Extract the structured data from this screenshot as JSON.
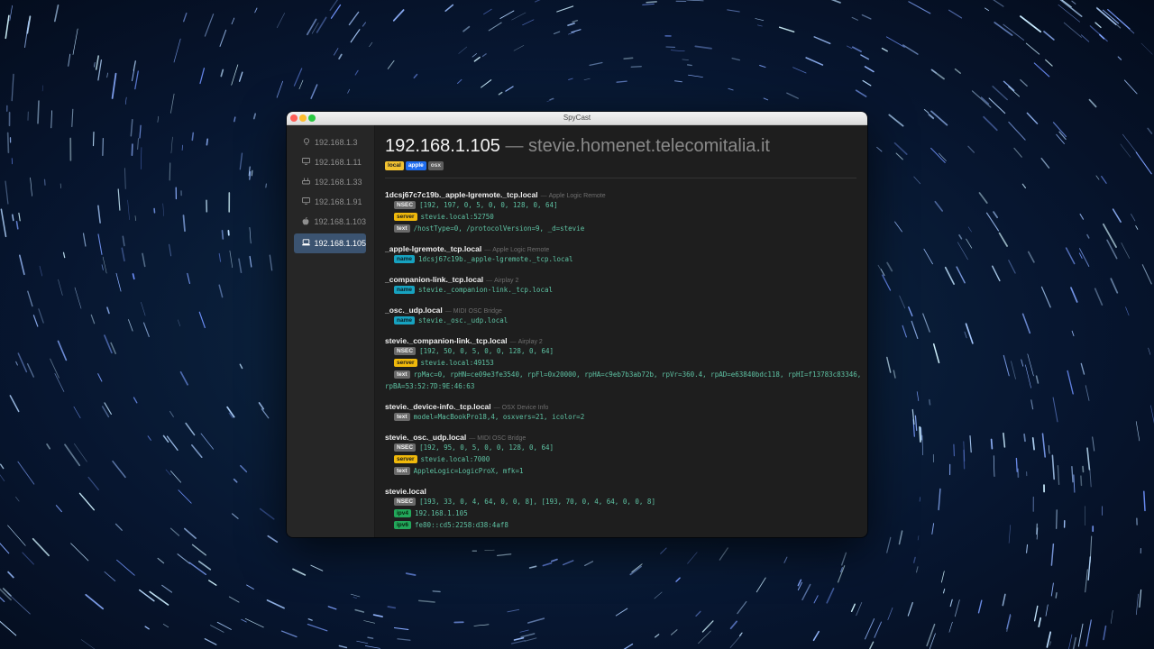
{
  "window": {
    "title": "SpyCast"
  },
  "sidebar": {
    "items": [
      {
        "label": "192.168.1.3",
        "icon": "lightbulb-icon"
      },
      {
        "label": "192.168.1.11",
        "icon": "monitor-icon"
      },
      {
        "label": "192.168.1.33",
        "icon": "router-icon"
      },
      {
        "label": "192.168.1.91",
        "icon": "monitor-icon"
      },
      {
        "label": "192.168.1.103",
        "icon": "apple-icon"
      },
      {
        "label": "192.168.1.105",
        "icon": "laptop-icon",
        "active": true
      }
    ]
  },
  "main": {
    "ip": "192.168.1.105",
    "dash": "—",
    "hostname": "stevie.homenet.telecomitalia.it",
    "tags": [
      "local",
      "apple",
      "osx"
    ]
  },
  "services": [
    {
      "name": "1dcsj67c7c19b._apple-lgremote._tcp.local",
      "description": "Apple Logic Remote",
      "records": [
        {
          "type": "NSEC",
          "value": "[192, 197, 0, 5, 0, 0, 128, 0, 64]"
        },
        {
          "type": "server",
          "value": "stevie.local:52750"
        },
        {
          "type": "text",
          "value": "/hostType=0, /protocolVersion=9, _d=stevie"
        }
      ]
    },
    {
      "name": "_apple-lgremote._tcp.local",
      "description": "Apple Logic Remote",
      "records": [
        {
          "type": "name",
          "value": "1dcsj67c19b._apple-lgremote._tcp.local"
        }
      ]
    },
    {
      "name": "_companion-link._tcp.local",
      "description": "Airplay 2",
      "records": [
        {
          "type": "name",
          "value": "stevie._companion-link._tcp.local"
        }
      ]
    },
    {
      "name": "_osc._udp.local",
      "description": "MIDI OSC Bridge",
      "records": [
        {
          "type": "name",
          "value": "stevie._osc._udp.local"
        }
      ]
    },
    {
      "name": "stevie._companion-link._tcp.local",
      "description": "Airplay 2",
      "records": [
        {
          "type": "NSEC",
          "value": "[192, 50, 0, 5, 0, 0, 128, 0, 64]"
        },
        {
          "type": "server",
          "value": "stevie.local:49153"
        },
        {
          "type": "text",
          "value": "rpMac=0, rpHN=ce09e3fe3540, rpFl=0x20000, rpHA=c9eb7b3ab72b, rpVr=360.4, rpAD=e63840bdc118, rpHI=f13783c83346,",
          "continuation": "rpBA=53:52:7D:9E:46:63"
        }
      ]
    },
    {
      "name": "stevie._device-info._tcp.local",
      "description": "OSX Device Info",
      "records": [
        {
          "type": "text",
          "value": "model=MacBookPro18,4, osxvers=21, icolor=2"
        }
      ]
    },
    {
      "name": "stevie._osc._udp.local",
      "description": "MIDI OSC Bridge",
      "records": [
        {
          "type": "NSEC",
          "value": "[192, 95, 0, 5, 0, 0, 128, 0, 64]"
        },
        {
          "type": "server",
          "value": "stevie.local:7000"
        },
        {
          "type": "text",
          "value": "AppleLogic=LogicProX, mfk=1"
        }
      ]
    },
    {
      "name": "stevie.local",
      "description": "",
      "records": [
        {
          "type": "NSEC",
          "value": "[193, 33, 0, 4, 64, 0, 0, 8], [193, 70, 0, 4, 64, 0, 0, 8]"
        },
        {
          "type": "ipv4",
          "value": "192.168.1.105"
        },
        {
          "type": "ipv6",
          "value": "fe80::cd5:2258:d38:4af8"
        }
      ]
    }
  ],
  "separator": "—",
  "colors": {
    "local": "#f2c230",
    "apple": "#1f6df0",
    "osx": "#5d5d5d",
    "server": "#f0b90b",
    "name": "#17a2c0",
    "ip": "#22a75a",
    "value_text": "#5ec2a3",
    "sidebar_active": "#3b5370"
  }
}
